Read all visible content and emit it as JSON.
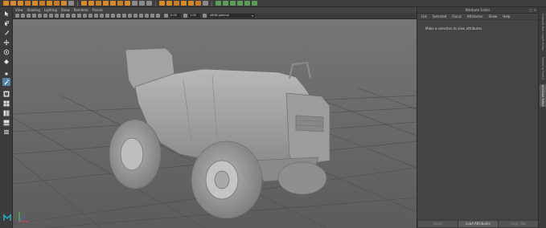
{
  "viewport": {
    "menu": [
      "View",
      "Shading",
      "Lighting",
      "Show",
      "Renderer",
      "Panels"
    ],
    "fields": {
      "near": "0.00",
      "far": "1.00"
    },
    "colorspace": "sRGB gamma"
  },
  "attribute_editor": {
    "title": "Attribute Editor",
    "menu": [
      "List",
      "Selected",
      "Focus",
      "Attributes",
      "Show",
      "Help"
    ],
    "message": "Make a selection to view attributes.",
    "buttons": {
      "select": "Select",
      "load": "Load Attributes",
      "copy": "Copy Tab"
    }
  },
  "side_tabs": [
    "Channel Box / Layer Editor",
    "Modeling Toolkit",
    "Attribute Editor"
  ],
  "colors": {
    "accent": "#5285a6",
    "viewport_bg": "#6b6b6b",
    "panel_bg": "#444444"
  }
}
